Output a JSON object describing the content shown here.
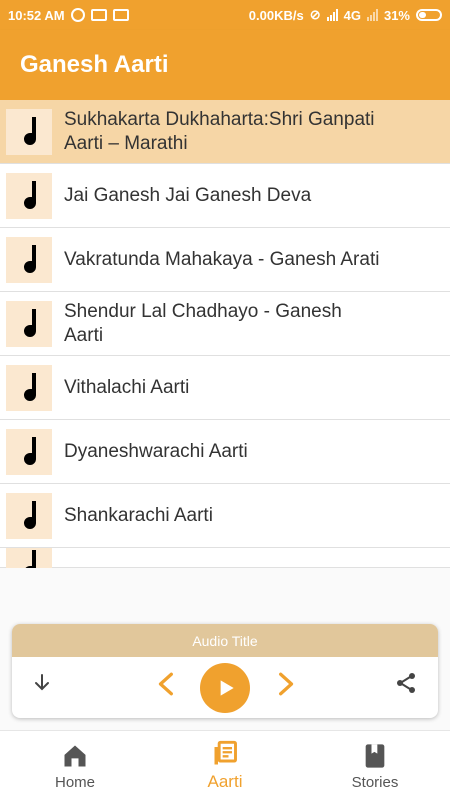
{
  "statusbar": {
    "time": "10:52 AM",
    "network_speed": "0.00KB/s",
    "network_type": "4G",
    "battery": "31%"
  },
  "appbar": {
    "title": "Ganesh Aarti"
  },
  "list": {
    "items": [
      {
        "label": "Sukhakarta Dukhaharta:Shri Ganpati Aarti – Marathi",
        "selected": true
      },
      {
        "label": "Jai Ganesh Jai Ganesh Deva"
      },
      {
        "label": "Vakratunda Mahakaya - Ganesh Arati"
      },
      {
        "label": "Shendur Lal Chadhayo - Ganesh Aarti"
      },
      {
        "label": "Vithalachi Aarti"
      },
      {
        "label": "Dyaneshwarachi Aarti"
      },
      {
        "label": "Shankarachi Aarti"
      }
    ],
    "item_icon": "music-note-icon",
    "selected_color": "#f6d6a6"
  },
  "player": {
    "title": "Audio Title",
    "icons": [
      "download-icon",
      "previous-icon",
      "play-icon",
      "next-icon",
      "share-icon"
    ]
  },
  "bottomnav": {
    "items": [
      {
        "label": "Home",
        "icon": "home-icon"
      },
      {
        "label": "Aarti",
        "icon": "library-icon",
        "active": true
      },
      {
        "label": "Stories",
        "icon": "book-icon"
      }
    ]
  },
  "colors": {
    "accent": "#f0a12e",
    "player_header": "#e1c79b",
    "thumb_bg": "#fbe8d0"
  }
}
